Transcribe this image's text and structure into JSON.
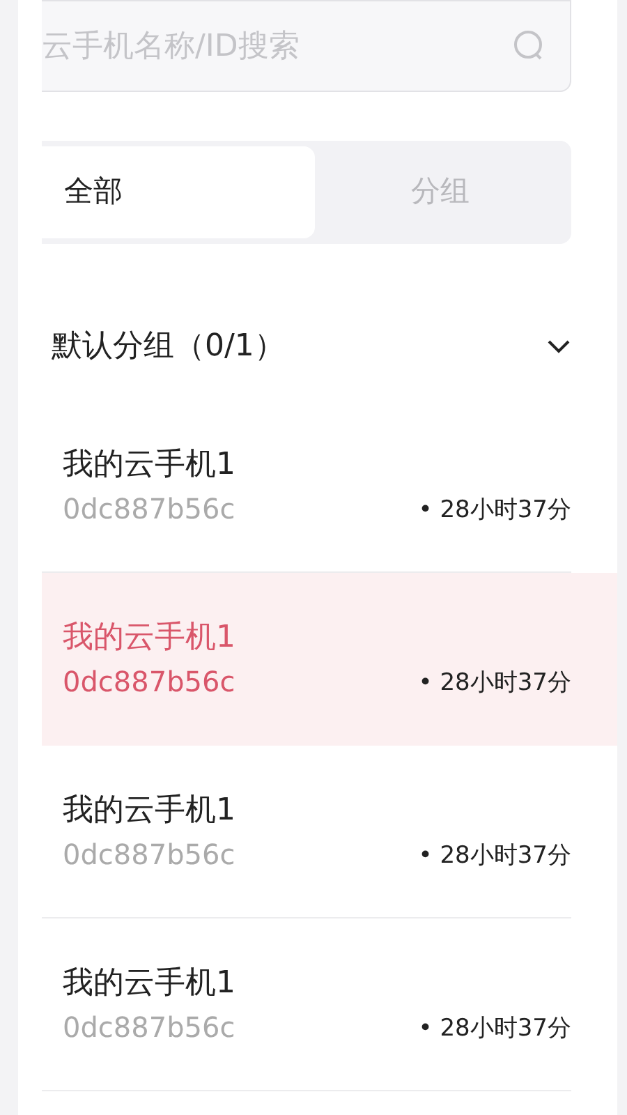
{
  "search": {
    "placeholder": "云手机名称/ID搜索"
  },
  "tabs": [
    {
      "label": "全部",
      "selected": true
    },
    {
      "label": "分组",
      "selected": false
    }
  ],
  "group": {
    "title": "默认分组（0/1）",
    "expanded": true
  },
  "devices": [
    {
      "name": "我的云手机1",
      "id": "0dc887b56c",
      "time": "• 28小时37分",
      "selected": false
    },
    {
      "name": "我的云手机1",
      "id": "0dc887b56c",
      "time": "• 28小时37分",
      "selected": true
    },
    {
      "name": "我的云手机1",
      "id": "0dc887b56c",
      "time": "• 28小时37分",
      "selected": false
    },
    {
      "name": "我的云手机1",
      "id": "0dc887b56c",
      "time": "• 28小时37分",
      "selected": false
    }
  ]
}
